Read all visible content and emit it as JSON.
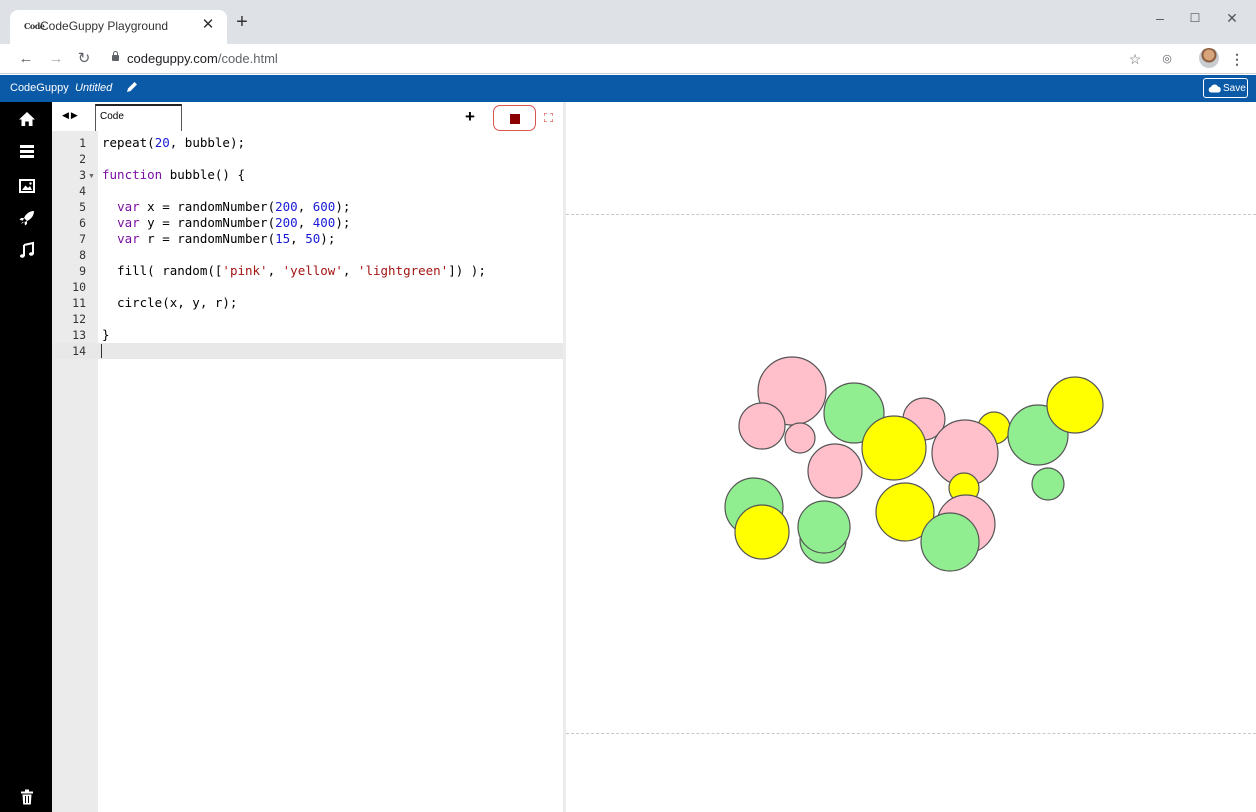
{
  "browser": {
    "tab": {
      "favicon_text": "Code",
      "title": "CodeGuppy Playground"
    },
    "url": {
      "host": "codeguppy.com",
      "path": "/code.html"
    }
  },
  "app": {
    "brand": "CodeGuppy",
    "project_name": "Untitled",
    "save_label": "Save"
  },
  "editor": {
    "tab_label": "Code",
    "lines": [
      "repeat(20, bubble);",
      "",
      "function bubble() {",
      "",
      "  var x = randomNumber(200, 600);",
      "  var y = randomNumber(200, 400);",
      "  var r = randomNumber(15, 50);",
      "",
      "  fill( random(['pink', 'yellow', 'lightgreen']) );",
      "",
      "  circle(x, y, r);",
      "",
      "}",
      ""
    ],
    "line_numbers": [
      "1",
      "2",
      "3",
      "4",
      "5",
      "6",
      "7",
      "8",
      "9",
      "10",
      "11",
      "12",
      "13",
      "14"
    ],
    "active_line": 14
  },
  "colors": {
    "pink": "#ffc0cb",
    "yellow": "#ffff00",
    "lightgreen": "#90ee90",
    "accent": "#0b5aa8",
    "stop": "#8b0000"
  },
  "icons": {
    "sidebar": [
      "home-icon",
      "menu-icon",
      "image-icon",
      "rocket-icon",
      "music-icon",
      "trash-icon"
    ]
  },
  "circles": [
    {
      "fill": "pink"
    },
    {
      "fill": "pink"
    },
    {
      "fill": "pink"
    },
    {
      "fill": "lightgreen"
    },
    {
      "fill": "pink"
    },
    {
      "fill": "yellow"
    },
    {
      "fill": "yellow"
    },
    {
      "fill": "pink"
    },
    {
      "fill": "pink"
    },
    {
      "fill": "yellow"
    },
    {
      "fill": "lightgreen"
    },
    {
      "fill": "yellow"
    },
    {
      "fill": "lightgreen"
    },
    {
      "fill": "lightgreen"
    },
    {
      "fill": "yellow"
    },
    {
      "fill": "lightgreen"
    },
    {
      "fill": "pink"
    },
    {
      "fill": "lightgreen"
    },
    {
      "fill": "lightgreen"
    },
    {
      "fill": "yellow"
    }
  ]
}
